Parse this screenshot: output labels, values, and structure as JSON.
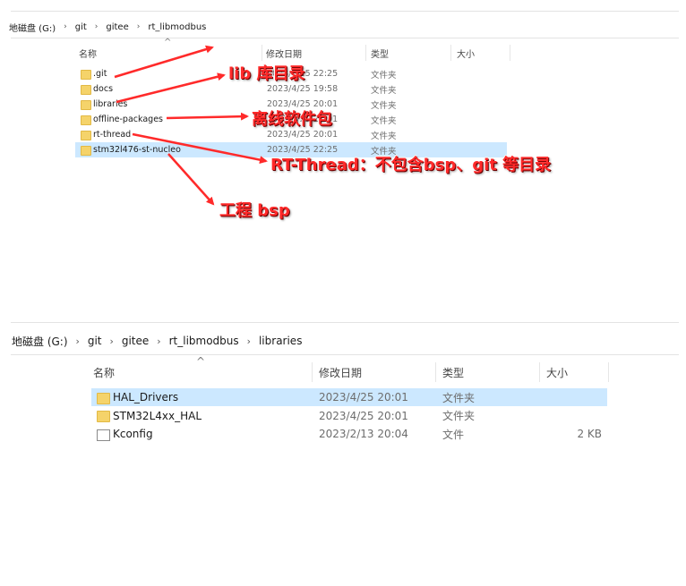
{
  "explorer1": {
    "breadcrumb": [
      "地磁盘 (G:)",
      "git",
      "gitee",
      "rt_libmodbus"
    ],
    "columns": {
      "name": "名称",
      "date": "修改日期",
      "type": "类型",
      "size": "大小"
    },
    "rows": [
      {
        "name": ".git",
        "date": "2023/4/25 22:25",
        "type": "文件夹",
        "icon": "folder-icon",
        "selected": false
      },
      {
        "name": "docs",
        "date": "2023/4/25 19:58",
        "type": "文件夹",
        "icon": "folder-icon",
        "selected": false
      },
      {
        "name": "libraries",
        "date": "2023/4/25 20:01",
        "type": "文件夹",
        "icon": "folder-icon",
        "selected": false
      },
      {
        "name": "offline-packages",
        "date": "2023/4/25 20:01",
        "type": "文件夹",
        "icon": "folder-icon",
        "selected": false
      },
      {
        "name": "rt-thread",
        "date": "2023/4/25 20:01",
        "type": "文件夹",
        "icon": "folder-icon",
        "selected": false
      },
      {
        "name": "stm32l476-st-nucleo",
        "date": "2023/4/25 22:25",
        "type": "文件夹",
        "icon": "folder-icon",
        "selected": true
      }
    ]
  },
  "annotations": {
    "lib": "lib 库目录",
    "offline": "离线软件包",
    "rtthread": "RT-Thread：不包含bsp、git 等目录",
    "bsp": "工程 bsp"
  },
  "explorer2": {
    "breadcrumb": [
      "地磁盘 (G:)",
      "git",
      "gitee",
      "rt_libmodbus",
      "libraries"
    ],
    "columns": {
      "name": "名称",
      "date": "修改日期",
      "type": "类型",
      "size": "大小"
    },
    "rows": [
      {
        "name": "HAL_Drivers",
        "date": "2023/4/25 20:01",
        "type": "文件夹",
        "size": "",
        "icon": "folder-icon",
        "selected": true
      },
      {
        "name": "STM32L4xx_HAL",
        "date": "2023/4/25 20:01",
        "type": "文件夹",
        "size": "",
        "icon": "folder-icon",
        "selected": false
      },
      {
        "name": "Kconfig",
        "date": "2023/2/13 20:04",
        "type": "文件",
        "size": "2 KB",
        "icon": "file-icon",
        "selected": false
      }
    ]
  },
  "colors": {
    "selection": "#cce8ff",
    "annotation": "#ff2a2a",
    "folder": "#f5d36a"
  }
}
